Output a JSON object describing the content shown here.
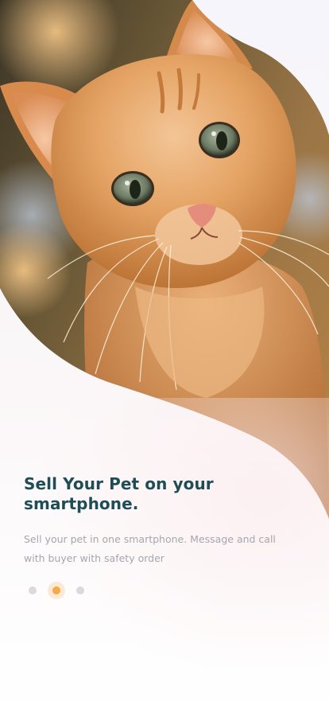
{
  "onboarding": {
    "title_line1": "Sell Your Pet on your",
    "title_line2": "smartphone.",
    "description_line1": "Sell your pet in one smartphone. Message and call",
    "description_line2": "with buyer with safety order",
    "pager": {
      "total": 3,
      "active_index": 2
    }
  },
  "colors": {
    "title": "#1f4d55",
    "description": "#a6a6ad",
    "dot_inactive": "#d9d9de",
    "dot_active": "#f5a947"
  }
}
